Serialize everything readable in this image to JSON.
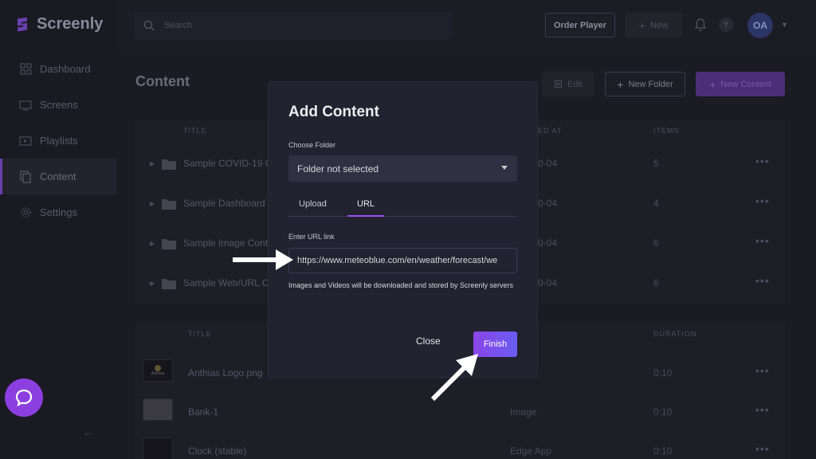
{
  "app": {
    "name": "Screenly"
  },
  "sidebar": {
    "items": [
      {
        "label": "Dashboard",
        "icon": "dashboard-icon",
        "active": false
      },
      {
        "label": "Screens",
        "icon": "screen-icon",
        "active": false
      },
      {
        "label": "Playlists",
        "icon": "playlist-icon",
        "active": false
      },
      {
        "label": "Content",
        "icon": "content-icon",
        "active": true
      },
      {
        "label": "Settings",
        "icon": "gear-icon",
        "active": false
      }
    ],
    "collapse": "←"
  },
  "topbar": {
    "search_placeholder": "Search",
    "order_player": "Order Player",
    "new_label": "New",
    "help": "?",
    "avatar": "OA"
  },
  "main": {
    "title": "Content",
    "edit_label": "Edit",
    "new_folder_label": "New Folder",
    "new_content_label": "New Content",
    "folders_table": {
      "headers": {
        "title": "TITLE",
        "created": "ED AT",
        "items": "ITEMS"
      },
      "rows": [
        {
          "name": "Sample COVID-19 C",
          "date": "0-04",
          "items": "5"
        },
        {
          "name": "Sample Dashboard",
          "date": "0-04",
          "items": "4"
        },
        {
          "name": "Sample Image Cont",
          "date": "0-04",
          "items": "6"
        },
        {
          "name": "Sample Web/URL C",
          "date": "0-04",
          "items": "6"
        }
      ]
    },
    "files_table": {
      "headers": {
        "title": "TITLE",
        "duration": "DURATION"
      },
      "rows": [
        {
          "name": "Anthias Logo.png",
          "type": "",
          "duration": "0:10",
          "thumb_text": "Anthias"
        },
        {
          "name": "Bank-1",
          "type": "Image",
          "duration": "0:10",
          "thumb_text": ""
        },
        {
          "name": "Clock (stable)",
          "type": "Edge App",
          "duration": "0:10",
          "thumb_text": ""
        }
      ]
    }
  },
  "modal": {
    "title": "Add Content",
    "folder_label": "Choose Folder",
    "folder_value": "Folder not selected",
    "tabs": {
      "upload": "Upload",
      "url": "URL"
    },
    "url_label": "Enter URL link",
    "url_value": "https://www.meteoblue.com/en/weather/forecast/we",
    "hint": "Images and Videos will be downloaded and stored by Screenly servers",
    "close": "Close",
    "finish": "Finish"
  },
  "colors": {
    "accent": "#8a45e8",
    "background": "#1b1b23",
    "modal": "#222231"
  }
}
